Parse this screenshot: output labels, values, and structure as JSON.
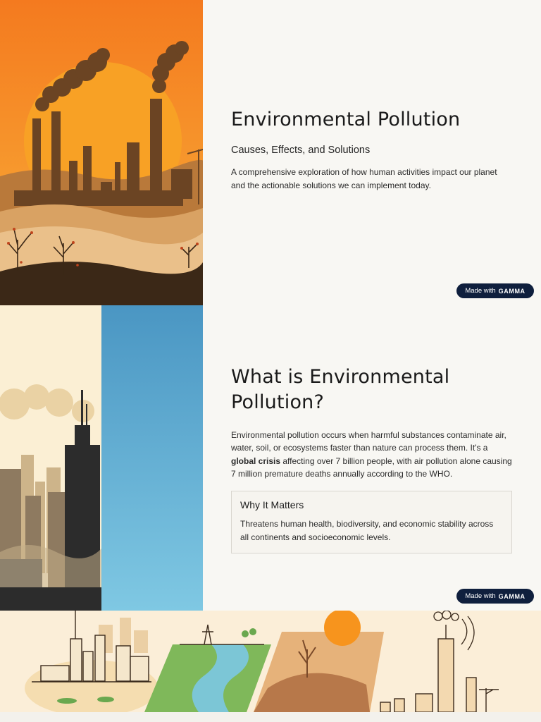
{
  "slide1": {
    "title": "Environmental Pollution",
    "subtitle": "Causes, Effects, and Solutions",
    "description": "A comprehensive exploration of how human activities impact our planet and the actionable solutions we can implement today.",
    "badge": {
      "prefix": "Made with",
      "brand": "GAMMA"
    },
    "image": "factory-smokestacks-sunset-illustration"
  },
  "slide2": {
    "title": "What is Environmental Pollution?",
    "body_part1": "Environmental pollution occurs when harmful substances contaminate air, water, soil, or ecosystems faster than nature can process them. It's a ",
    "body_bold": "global crisis",
    "body_part2": " affecting over 7 billion people, with air pollution alone causing 7 million premature deaths annually according to the WHO.",
    "callout": {
      "title": "Why It Matters",
      "text": "Threatens human health, biodiversity, and economic stability across all continents and socioeconomic levels."
    },
    "badge": {
      "prefix": "Made with",
      "brand": "GAMMA"
    },
    "image": "smoggy-city-skyline-illustration"
  },
  "slide3": {
    "image": "pollution-types-illustration-strip"
  },
  "colors": {
    "badge_bg": "#0f1f3d",
    "slide_bg": "#f8f7f3",
    "sun": "#f7941d"
  }
}
